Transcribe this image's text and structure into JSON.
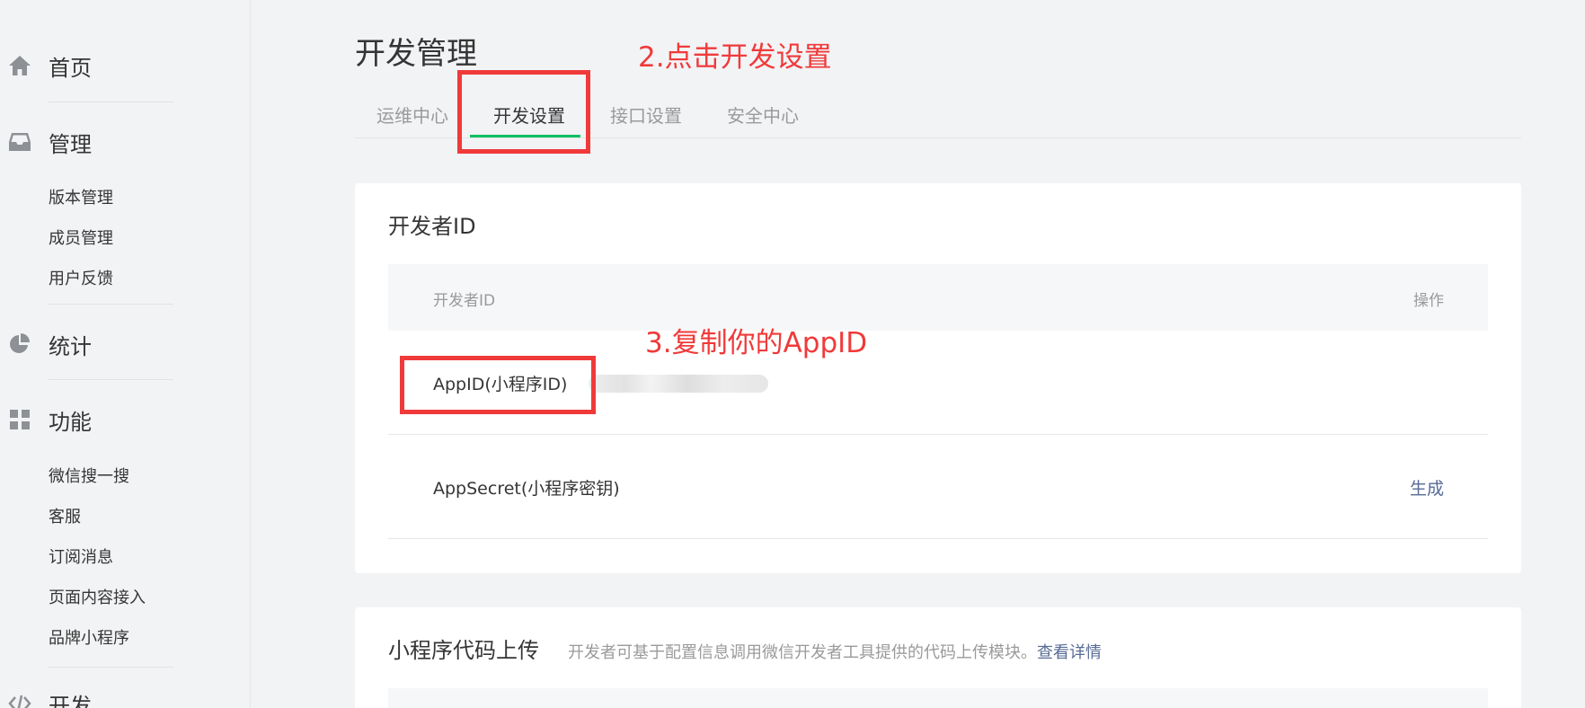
{
  "sidebar": {
    "home": {
      "label": "首页",
      "icon": "home-icon"
    },
    "manage": {
      "label": "管理",
      "icon": "inbox-icon",
      "items": [
        "版本管理",
        "成员管理",
        "用户反馈"
      ]
    },
    "stats": {
      "label": "统计",
      "icon": "pie-chart-icon"
    },
    "features": {
      "label": "功能",
      "icon": "grid-icon",
      "items": [
        "微信搜一搜",
        "客服",
        "订阅消息",
        "页面内容接入",
        "品牌小程序"
      ]
    },
    "dev": {
      "label": "开发",
      "icon": "code-icon"
    }
  },
  "page": {
    "title": "开发管理",
    "tabs": [
      "运维中心",
      "开发设置",
      "接口设置",
      "安全中心"
    ],
    "active_tab": "开发设置"
  },
  "developer_id": {
    "title": "开发者ID",
    "columns": {
      "name": "开发者ID",
      "action": "操作"
    },
    "rows": [
      {
        "label": "AppID(小程序ID)",
        "value": "",
        "action": ""
      },
      {
        "label": "AppSecret(小程序密钥)",
        "value": "",
        "action": "生成"
      }
    ]
  },
  "code_upload": {
    "title": "小程序代码上传",
    "description": "开发者可基于配置信息调用微信开发者工具提供的代码上传模块。",
    "link": "查看详情"
  },
  "annotations": {
    "step2": "2.点击开发设置",
    "step3": "3.复制你的AppID"
  },
  "colors": {
    "annotation": "#f03a3a",
    "tab_active": "#07c160",
    "link": "#576b95"
  }
}
